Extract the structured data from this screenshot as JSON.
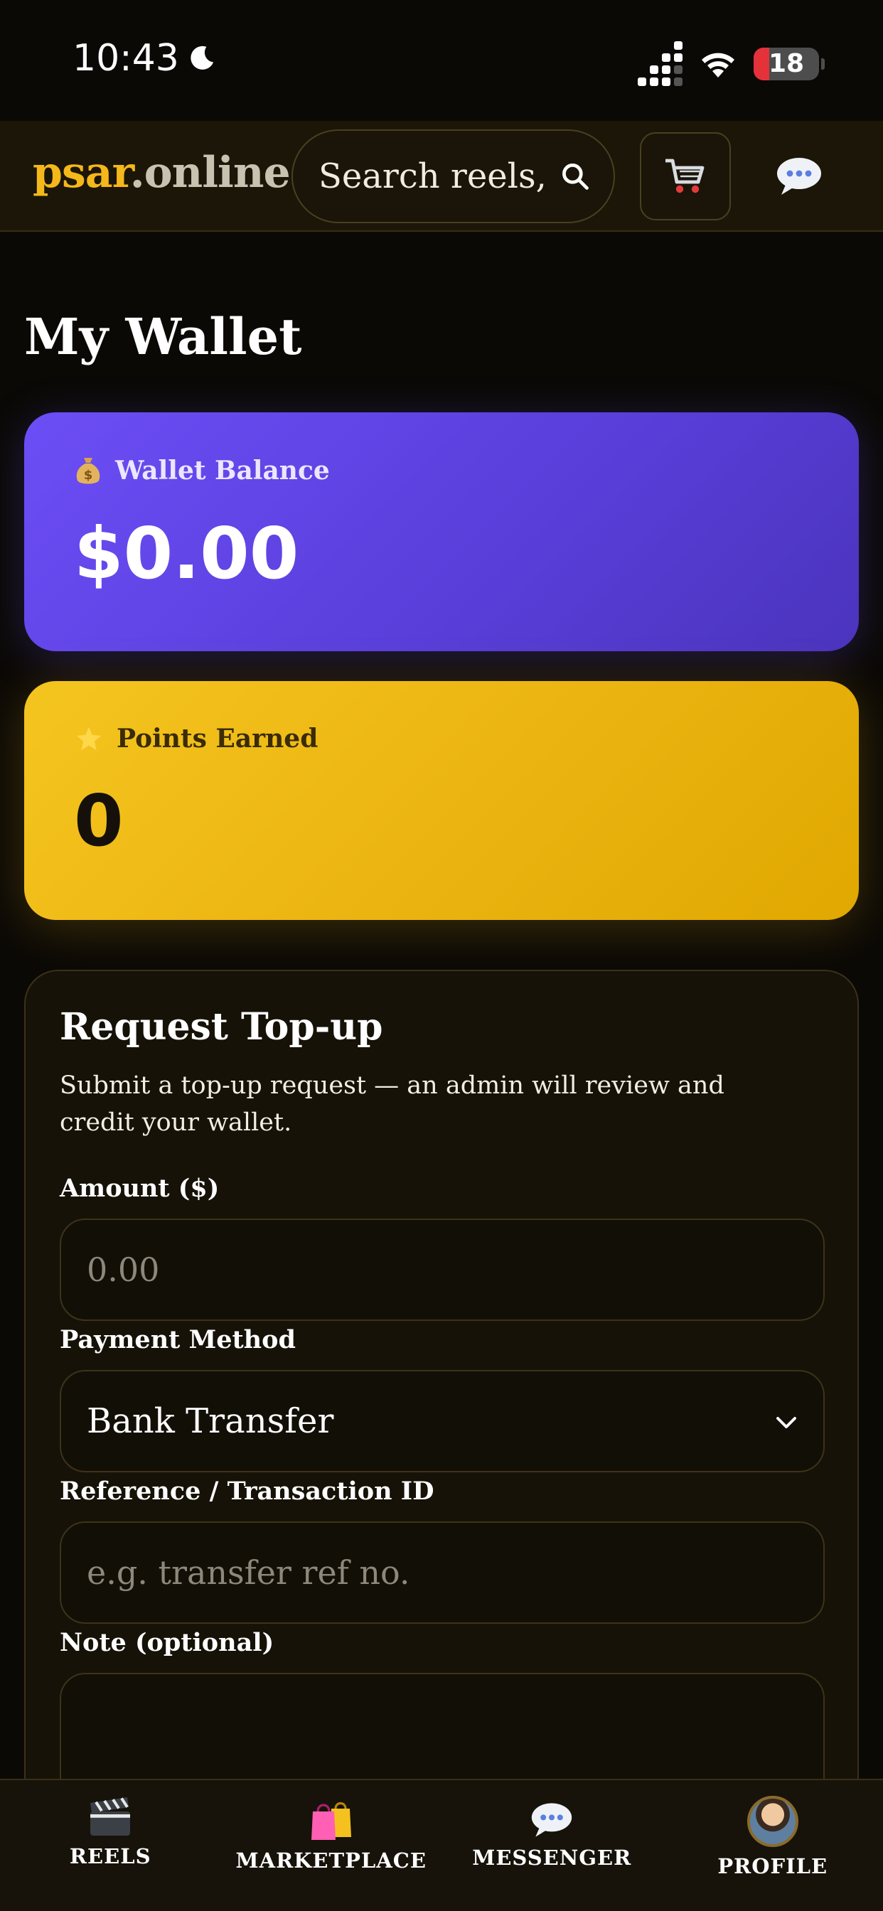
{
  "status_bar": {
    "time": "10:43",
    "battery": "18"
  },
  "header": {
    "logo_part1": "psar",
    "logo_part2": ".online",
    "search_placeholder": "Search reels, l"
  },
  "page": {
    "title": "My Wallet"
  },
  "wallet_card": {
    "icon": "money-bag-icon",
    "label": "Wallet Balance",
    "value": "$0.00"
  },
  "points_card": {
    "icon": "star-icon",
    "label": "Points Earned",
    "value": "0"
  },
  "topup": {
    "title": "Request Top-up",
    "description": "Submit a top-up request — an admin will review and credit your wallet.",
    "amount_label": "Amount ($)",
    "amount_placeholder": "0.00",
    "method_label": "Payment Method",
    "method_value": "Bank Transfer",
    "reference_label": "Reference / Transaction ID",
    "reference_placeholder": "e.g. transfer ref no.",
    "note_label": "Note (optional)"
  },
  "bottom_nav": {
    "reels": "REELS",
    "marketplace": "MARKETPLACE",
    "messenger": "MESSENGER",
    "profile": "PROFILE"
  },
  "colors": {
    "brand_yellow": "#f5b81a",
    "wallet_purple": "#6c4ef6",
    "points_yellow": "#f0b916",
    "background": "#0b0906"
  }
}
